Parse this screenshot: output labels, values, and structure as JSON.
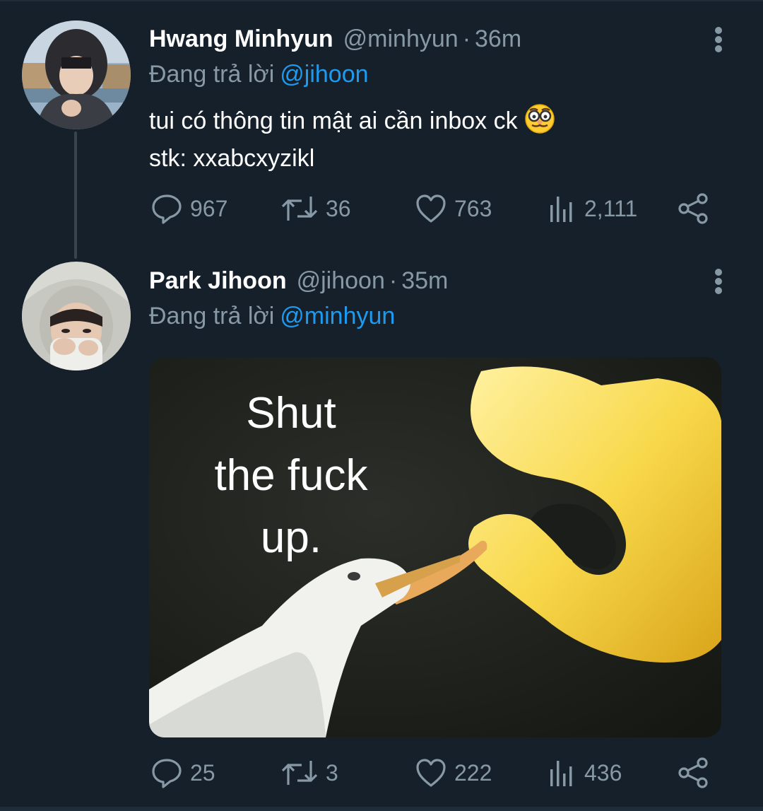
{
  "tweets": [
    {
      "name": "Hwang Minhyun",
      "handle": "@minhyun",
      "separator": "·",
      "time": "36m",
      "reply_prefix": "Đang trả lời",
      "reply_to": "@jihoon",
      "text_line1": "tui có thông tin mật ai cần inbox ck",
      "text_line2": "stk: xxabcxyzikl",
      "emoji": "disguised-face-emoji",
      "replies": "967",
      "retweets": "36",
      "likes": "763",
      "views": "2,111"
    },
    {
      "name": "Park Jihoon",
      "handle": "@jihoon",
      "separator": "·",
      "time": "35m",
      "reply_prefix": "Đang trả lời",
      "reply_to": "@minhyun",
      "media_caption_1": "Shut",
      "media_caption_2": "the fuck",
      "media_caption_3": "up.",
      "replies": "25",
      "retweets": "3",
      "likes": "222",
      "views": "436"
    }
  ],
  "icons": {
    "reply": "reply-icon",
    "retweet": "retweet-icon",
    "like": "heart-icon",
    "views": "views-icon",
    "share": "share-icon",
    "more": "more-options-icon"
  },
  "colors": {
    "background": "#15202b",
    "text": "#ffffff",
    "muted": "#8899a6",
    "link": "#1d9bf0",
    "thread_line": "#38444d"
  }
}
